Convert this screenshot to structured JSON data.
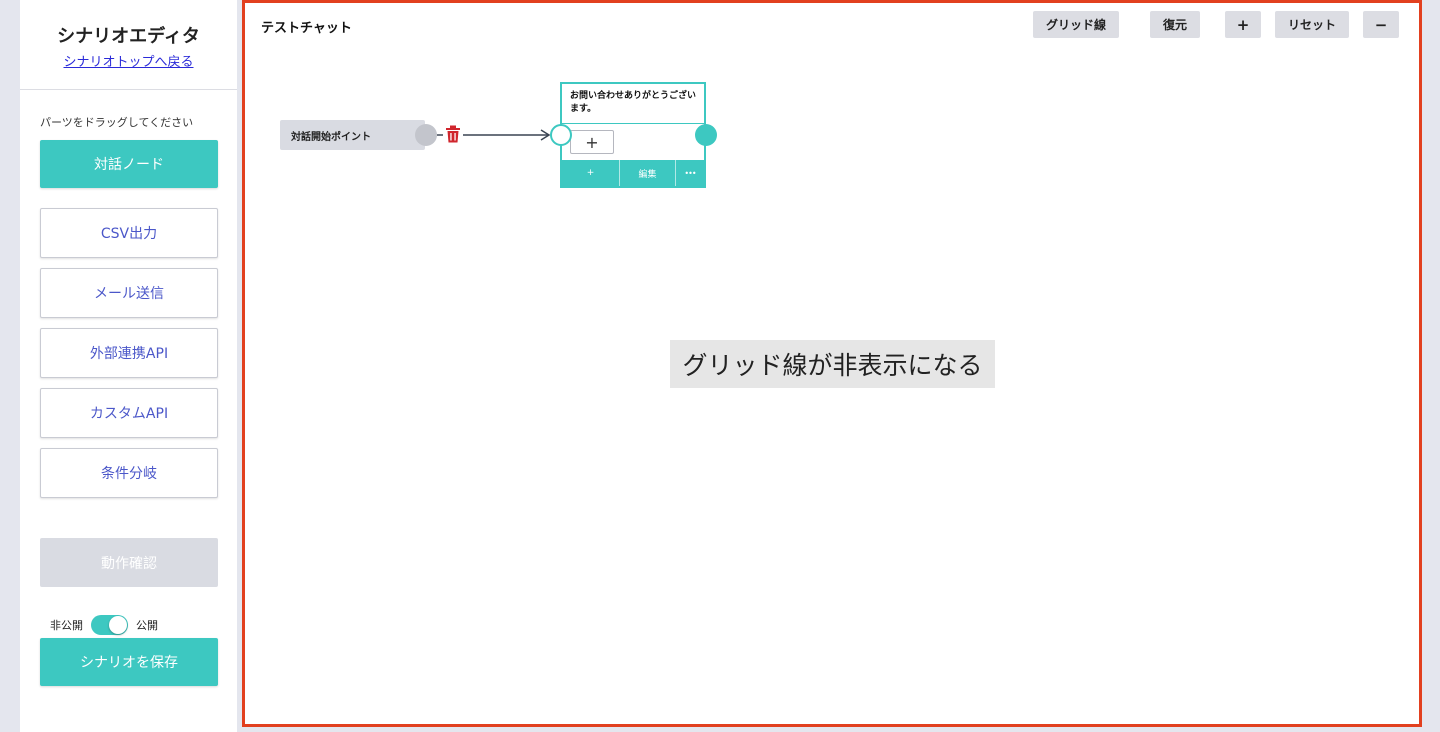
{
  "sidebar": {
    "title": "シナリオエディタ",
    "back_link": "シナリオトップへ戻る",
    "hint": "パーツをドラッグしてください",
    "primary_part": "対話ノード",
    "parts": [
      "CSV出力",
      "メール送信",
      "外部連携API",
      "カスタムAPI",
      "条件分岐"
    ],
    "check_button": "動作確認",
    "private_label": "非公開",
    "public_label": "公開",
    "save_button": "シナリオを保存"
  },
  "canvas": {
    "chat_name": "テストチャット",
    "toolbar": {
      "grid": "グリッド線",
      "restore": "復元",
      "zoom_in": "+",
      "reset": "リセット",
      "zoom_out": "−"
    },
    "start_node": {
      "label": "対話開始ポイント"
    },
    "dialog_node": {
      "text": "お問い合わせありがとうございます。",
      "add_choice": "+",
      "footer_add": "+",
      "footer_edit": "編集",
      "footer_more": "•••"
    },
    "overlay_text": "グリッド線が非表示になる"
  },
  "colors": {
    "accent": "#3dc8c1",
    "highlight_border": "#e2401f",
    "link": "#2a2ad8",
    "part_text": "#4b57c9",
    "trash": "#d0262d"
  }
}
